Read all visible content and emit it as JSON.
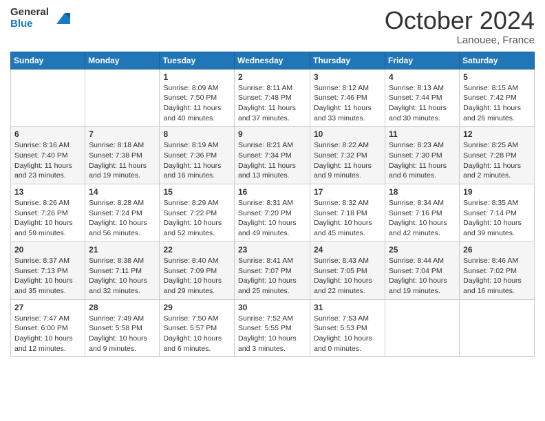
{
  "header": {
    "logo_line1": "General",
    "logo_line2": "Blue",
    "month": "October 2024",
    "location": "Lanouee, France"
  },
  "weekdays": [
    "Sunday",
    "Monday",
    "Tuesday",
    "Wednesday",
    "Thursday",
    "Friday",
    "Saturday"
  ],
  "weeks": [
    [
      {
        "day": "",
        "sunrise": "",
        "sunset": "",
        "daylight": ""
      },
      {
        "day": "",
        "sunrise": "",
        "sunset": "",
        "daylight": ""
      },
      {
        "day": "1",
        "sunrise": "Sunrise: 8:09 AM",
        "sunset": "Sunset: 7:50 PM",
        "daylight": "Daylight: 11 hours and 40 minutes."
      },
      {
        "day": "2",
        "sunrise": "Sunrise: 8:11 AM",
        "sunset": "Sunset: 7:48 PM",
        "daylight": "Daylight: 11 hours and 37 minutes."
      },
      {
        "day": "3",
        "sunrise": "Sunrise: 8:12 AM",
        "sunset": "Sunset: 7:46 PM",
        "daylight": "Daylight: 11 hours and 33 minutes."
      },
      {
        "day": "4",
        "sunrise": "Sunrise: 8:13 AM",
        "sunset": "Sunset: 7:44 PM",
        "daylight": "Daylight: 11 hours and 30 minutes."
      },
      {
        "day": "5",
        "sunrise": "Sunrise: 8:15 AM",
        "sunset": "Sunset: 7:42 PM",
        "daylight": "Daylight: 11 hours and 26 minutes."
      }
    ],
    [
      {
        "day": "6",
        "sunrise": "Sunrise: 8:16 AM",
        "sunset": "Sunset: 7:40 PM",
        "daylight": "Daylight: 11 hours and 23 minutes."
      },
      {
        "day": "7",
        "sunrise": "Sunrise: 8:18 AM",
        "sunset": "Sunset: 7:38 PM",
        "daylight": "Daylight: 11 hours and 19 minutes."
      },
      {
        "day": "8",
        "sunrise": "Sunrise: 8:19 AM",
        "sunset": "Sunset: 7:36 PM",
        "daylight": "Daylight: 11 hours and 16 minutes."
      },
      {
        "day": "9",
        "sunrise": "Sunrise: 8:21 AM",
        "sunset": "Sunset: 7:34 PM",
        "daylight": "Daylight: 11 hours and 13 minutes."
      },
      {
        "day": "10",
        "sunrise": "Sunrise: 8:22 AM",
        "sunset": "Sunset: 7:32 PM",
        "daylight": "Daylight: 11 hours and 9 minutes."
      },
      {
        "day": "11",
        "sunrise": "Sunrise: 8:23 AM",
        "sunset": "Sunset: 7:30 PM",
        "daylight": "Daylight: 11 hours and 6 minutes."
      },
      {
        "day": "12",
        "sunrise": "Sunrise: 8:25 AM",
        "sunset": "Sunset: 7:28 PM",
        "daylight": "Daylight: 11 hours and 2 minutes."
      }
    ],
    [
      {
        "day": "13",
        "sunrise": "Sunrise: 8:26 AM",
        "sunset": "Sunset: 7:26 PM",
        "daylight": "Daylight: 10 hours and 59 minutes."
      },
      {
        "day": "14",
        "sunrise": "Sunrise: 8:28 AM",
        "sunset": "Sunset: 7:24 PM",
        "daylight": "Daylight: 10 hours and 56 minutes."
      },
      {
        "day": "15",
        "sunrise": "Sunrise: 8:29 AM",
        "sunset": "Sunset: 7:22 PM",
        "daylight": "Daylight: 10 hours and 52 minutes."
      },
      {
        "day": "16",
        "sunrise": "Sunrise: 8:31 AM",
        "sunset": "Sunset: 7:20 PM",
        "daylight": "Daylight: 10 hours and 49 minutes."
      },
      {
        "day": "17",
        "sunrise": "Sunrise: 8:32 AM",
        "sunset": "Sunset: 7:18 PM",
        "daylight": "Daylight: 10 hours and 45 minutes."
      },
      {
        "day": "18",
        "sunrise": "Sunrise: 8:34 AM",
        "sunset": "Sunset: 7:16 PM",
        "daylight": "Daylight: 10 hours and 42 minutes."
      },
      {
        "day": "19",
        "sunrise": "Sunrise: 8:35 AM",
        "sunset": "Sunset: 7:14 PM",
        "daylight": "Daylight: 10 hours and 39 minutes."
      }
    ],
    [
      {
        "day": "20",
        "sunrise": "Sunrise: 8:37 AM",
        "sunset": "Sunset: 7:13 PM",
        "daylight": "Daylight: 10 hours and 35 minutes."
      },
      {
        "day": "21",
        "sunrise": "Sunrise: 8:38 AM",
        "sunset": "Sunset: 7:11 PM",
        "daylight": "Daylight: 10 hours and 32 minutes."
      },
      {
        "day": "22",
        "sunrise": "Sunrise: 8:40 AM",
        "sunset": "Sunset: 7:09 PM",
        "daylight": "Daylight: 10 hours and 29 minutes."
      },
      {
        "day": "23",
        "sunrise": "Sunrise: 8:41 AM",
        "sunset": "Sunset: 7:07 PM",
        "daylight": "Daylight: 10 hours and 25 minutes."
      },
      {
        "day": "24",
        "sunrise": "Sunrise: 8:43 AM",
        "sunset": "Sunset: 7:05 PM",
        "daylight": "Daylight: 10 hours and 22 minutes."
      },
      {
        "day": "25",
        "sunrise": "Sunrise: 8:44 AM",
        "sunset": "Sunset: 7:04 PM",
        "daylight": "Daylight: 10 hours and 19 minutes."
      },
      {
        "day": "26",
        "sunrise": "Sunrise: 8:46 AM",
        "sunset": "Sunset: 7:02 PM",
        "daylight": "Daylight: 10 hours and 16 minutes."
      }
    ],
    [
      {
        "day": "27",
        "sunrise": "Sunrise: 7:47 AM",
        "sunset": "Sunset: 6:00 PM",
        "daylight": "Daylight: 10 hours and 12 minutes."
      },
      {
        "day": "28",
        "sunrise": "Sunrise: 7:49 AM",
        "sunset": "Sunset: 5:58 PM",
        "daylight": "Daylight: 10 hours and 9 minutes."
      },
      {
        "day": "29",
        "sunrise": "Sunrise: 7:50 AM",
        "sunset": "Sunset: 5:57 PM",
        "daylight": "Daylight: 10 hours and 6 minutes."
      },
      {
        "day": "30",
        "sunrise": "Sunrise: 7:52 AM",
        "sunset": "Sunset: 5:55 PM",
        "daylight": "Daylight: 10 hours and 3 minutes."
      },
      {
        "day": "31",
        "sunrise": "Sunrise: 7:53 AM",
        "sunset": "Sunset: 5:53 PM",
        "daylight": "Daylight: 10 hours and 0 minutes."
      },
      {
        "day": "",
        "sunrise": "",
        "sunset": "",
        "daylight": ""
      },
      {
        "day": "",
        "sunrise": "",
        "sunset": "",
        "daylight": ""
      }
    ]
  ]
}
